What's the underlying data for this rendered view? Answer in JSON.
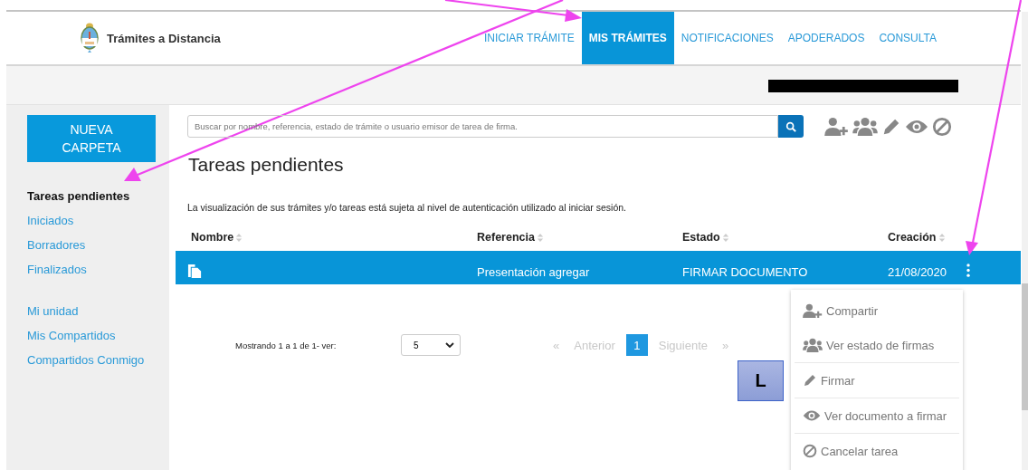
{
  "header": {
    "site_title": "Trámites a Distancia",
    "nav": [
      {
        "label": "INICIAR TRÁMITE",
        "selected": false
      },
      {
        "label": "MIS TRÁMITES",
        "selected": true
      },
      {
        "label": "NOTIFICACIONES",
        "selected": false
      },
      {
        "label": "APODERADOS",
        "selected": false
      },
      {
        "label": "CONSULTA",
        "selected": false
      }
    ]
  },
  "sidebar": {
    "new_folder_button": "NUEVA CARPETA",
    "sections": [
      {
        "items": [
          {
            "label": "Tareas pendientes",
            "selected": true
          },
          {
            "label": "Iniciados",
            "selected": false
          },
          {
            "label": "Borradores",
            "selected": false
          },
          {
            "label": "Finalizados",
            "selected": false
          }
        ]
      },
      {
        "items": [
          {
            "label": "Mi unidad",
            "selected": false
          },
          {
            "label": "Mis Compartidos",
            "selected": false
          },
          {
            "label": "Compartidos Conmigo",
            "selected": false
          }
        ]
      }
    ]
  },
  "search": {
    "placeholder": "Buscar por nombre, referencia, estado de trámite o usuario emisor de tarea de firma."
  },
  "title": "Tareas pendientes",
  "note": "La visualización de sus trámites y/o tareas está sujeta al nivel de autenticación utilizado al iniciar sesión.",
  "table": {
    "columns": [
      "Nombre",
      "Referencia",
      "Estado",
      "Creación"
    ],
    "rows": [
      {
        "cells": [
          "",
          "Presentación agregar",
          "FIRMAR DOCUMENTO",
          "21/08/2020"
        ],
        "selected": true
      }
    ]
  },
  "pagination": {
    "summary": "Mostrando 1 a 1 de 1- ver:",
    "page_size": "5",
    "first_arrow": "«",
    "previous": "Anterior",
    "pages": [
      {
        "label": "1",
        "selected": true
      }
    ],
    "next": "Siguiente",
    "last_arrow": "»",
    "previous_disabled": true,
    "next_disabled": true
  },
  "letter_tile": "L",
  "context_menu": [
    {
      "kind": "share",
      "label": "Compartir"
    },
    {
      "kind": "status",
      "label": "Ver estado de firmas"
    },
    {
      "kind": "sign",
      "label": "Firmar"
    },
    {
      "kind": "view",
      "label": "Ver documento a firmar"
    },
    {
      "kind": "cancel",
      "label": "Cancelar tarea"
    }
  ]
}
